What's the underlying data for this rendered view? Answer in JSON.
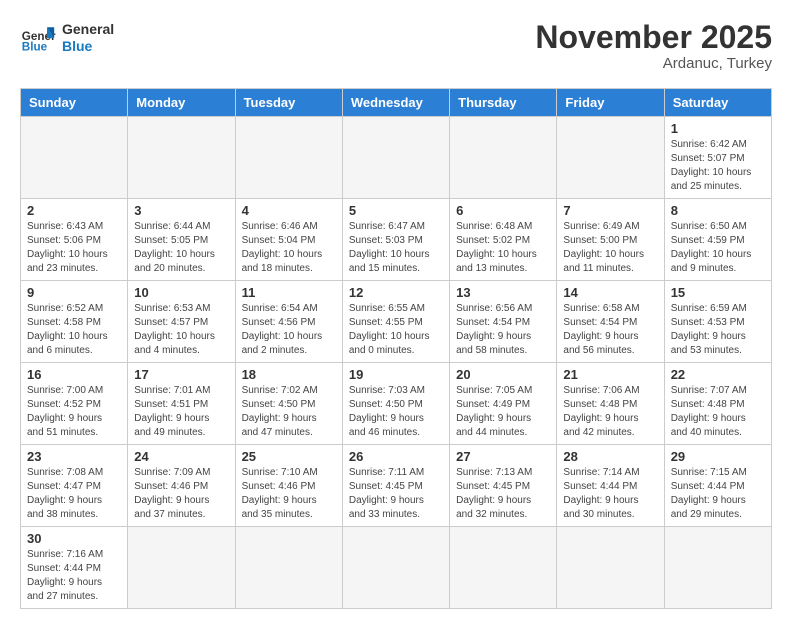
{
  "header": {
    "logo_general": "General",
    "logo_blue": "Blue",
    "month": "November 2025",
    "location": "Ardanuc, Turkey"
  },
  "days_of_week": [
    "Sunday",
    "Monday",
    "Tuesday",
    "Wednesday",
    "Thursday",
    "Friday",
    "Saturday"
  ],
  "weeks": [
    [
      {
        "day": "",
        "info": ""
      },
      {
        "day": "",
        "info": ""
      },
      {
        "day": "",
        "info": ""
      },
      {
        "day": "",
        "info": ""
      },
      {
        "day": "",
        "info": ""
      },
      {
        "day": "",
        "info": ""
      },
      {
        "day": "1",
        "info": "Sunrise: 6:42 AM\nSunset: 5:07 PM\nDaylight: 10 hours\nand 25 minutes."
      }
    ],
    [
      {
        "day": "2",
        "info": "Sunrise: 6:43 AM\nSunset: 5:06 PM\nDaylight: 10 hours\nand 23 minutes."
      },
      {
        "day": "3",
        "info": "Sunrise: 6:44 AM\nSunset: 5:05 PM\nDaylight: 10 hours\nand 20 minutes."
      },
      {
        "day": "4",
        "info": "Sunrise: 6:46 AM\nSunset: 5:04 PM\nDaylight: 10 hours\nand 18 minutes."
      },
      {
        "day": "5",
        "info": "Sunrise: 6:47 AM\nSunset: 5:03 PM\nDaylight: 10 hours\nand 15 minutes."
      },
      {
        "day": "6",
        "info": "Sunrise: 6:48 AM\nSunset: 5:02 PM\nDaylight: 10 hours\nand 13 minutes."
      },
      {
        "day": "7",
        "info": "Sunrise: 6:49 AM\nSunset: 5:00 PM\nDaylight: 10 hours\nand 11 minutes."
      },
      {
        "day": "8",
        "info": "Sunrise: 6:50 AM\nSunset: 4:59 PM\nDaylight: 10 hours\nand 9 minutes."
      }
    ],
    [
      {
        "day": "9",
        "info": "Sunrise: 6:52 AM\nSunset: 4:58 PM\nDaylight: 10 hours\nand 6 minutes."
      },
      {
        "day": "10",
        "info": "Sunrise: 6:53 AM\nSunset: 4:57 PM\nDaylight: 10 hours\nand 4 minutes."
      },
      {
        "day": "11",
        "info": "Sunrise: 6:54 AM\nSunset: 4:56 PM\nDaylight: 10 hours\nand 2 minutes."
      },
      {
        "day": "12",
        "info": "Sunrise: 6:55 AM\nSunset: 4:55 PM\nDaylight: 10 hours\nand 0 minutes."
      },
      {
        "day": "13",
        "info": "Sunrise: 6:56 AM\nSunset: 4:54 PM\nDaylight: 9 hours\nand 58 minutes."
      },
      {
        "day": "14",
        "info": "Sunrise: 6:58 AM\nSunset: 4:54 PM\nDaylight: 9 hours\nand 56 minutes."
      },
      {
        "day": "15",
        "info": "Sunrise: 6:59 AM\nSunset: 4:53 PM\nDaylight: 9 hours\nand 53 minutes."
      }
    ],
    [
      {
        "day": "16",
        "info": "Sunrise: 7:00 AM\nSunset: 4:52 PM\nDaylight: 9 hours\nand 51 minutes."
      },
      {
        "day": "17",
        "info": "Sunrise: 7:01 AM\nSunset: 4:51 PM\nDaylight: 9 hours\nand 49 minutes."
      },
      {
        "day": "18",
        "info": "Sunrise: 7:02 AM\nSunset: 4:50 PM\nDaylight: 9 hours\nand 47 minutes."
      },
      {
        "day": "19",
        "info": "Sunrise: 7:03 AM\nSunset: 4:50 PM\nDaylight: 9 hours\nand 46 minutes."
      },
      {
        "day": "20",
        "info": "Sunrise: 7:05 AM\nSunset: 4:49 PM\nDaylight: 9 hours\nand 44 minutes."
      },
      {
        "day": "21",
        "info": "Sunrise: 7:06 AM\nSunset: 4:48 PM\nDaylight: 9 hours\nand 42 minutes."
      },
      {
        "day": "22",
        "info": "Sunrise: 7:07 AM\nSunset: 4:48 PM\nDaylight: 9 hours\nand 40 minutes."
      }
    ],
    [
      {
        "day": "23",
        "info": "Sunrise: 7:08 AM\nSunset: 4:47 PM\nDaylight: 9 hours\nand 38 minutes."
      },
      {
        "day": "24",
        "info": "Sunrise: 7:09 AM\nSunset: 4:46 PM\nDaylight: 9 hours\nand 37 minutes."
      },
      {
        "day": "25",
        "info": "Sunrise: 7:10 AM\nSunset: 4:46 PM\nDaylight: 9 hours\nand 35 minutes."
      },
      {
        "day": "26",
        "info": "Sunrise: 7:11 AM\nSunset: 4:45 PM\nDaylight: 9 hours\nand 33 minutes."
      },
      {
        "day": "27",
        "info": "Sunrise: 7:13 AM\nSunset: 4:45 PM\nDaylight: 9 hours\nand 32 minutes."
      },
      {
        "day": "28",
        "info": "Sunrise: 7:14 AM\nSunset: 4:44 PM\nDaylight: 9 hours\nand 30 minutes."
      },
      {
        "day": "29",
        "info": "Sunrise: 7:15 AM\nSunset: 4:44 PM\nDaylight: 9 hours\nand 29 minutes."
      }
    ],
    [
      {
        "day": "30",
        "info": "Sunrise: 7:16 AM\nSunset: 4:44 PM\nDaylight: 9 hours\nand 27 minutes."
      },
      {
        "day": "",
        "info": ""
      },
      {
        "day": "",
        "info": ""
      },
      {
        "day": "",
        "info": ""
      },
      {
        "day": "",
        "info": ""
      },
      {
        "day": "",
        "info": ""
      },
      {
        "day": "",
        "info": ""
      }
    ]
  ]
}
